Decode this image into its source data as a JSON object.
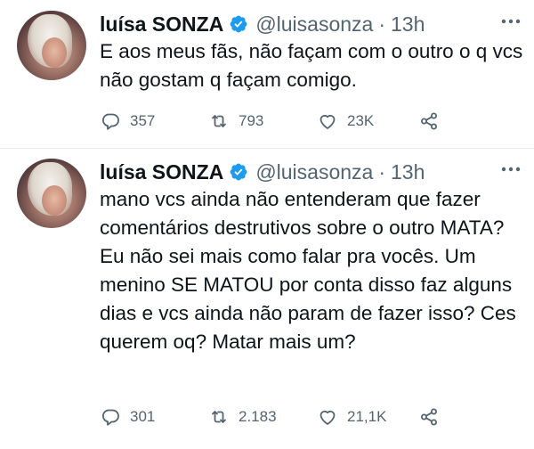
{
  "tweets": [
    {
      "author": {
        "name": "luísa SONZA",
        "handle": "@luisasonza",
        "verified": true
      },
      "separator": "·",
      "time": "13h",
      "text": "E aos meus fãs, não façam com o outro o q vcs não gostam q façam comigo.",
      "stats": {
        "replies": "357",
        "retweets": "793",
        "likes": "23K"
      }
    },
    {
      "author": {
        "name": "luísa SONZA",
        "handle": "@luisasonza",
        "verified": true
      },
      "separator": "·",
      "time": "13h",
      "text": "mano vcs ainda não entenderam que fazer comentários destrutivos sobre o outro MATA? Eu não sei mais como falar pra vocês. Um menino SE MATOU por conta disso faz alguns dias e vcs ainda não param de fazer isso? Ces querem oq? Matar mais um?",
      "stats": {
        "replies": "301",
        "retweets": "2.183",
        "likes": "21,1K"
      }
    }
  ],
  "colors": {
    "text": "#0f1419",
    "muted": "#536471",
    "verified": "#1d9bf0",
    "divider": "#e6ecf0"
  },
  "icons": [
    "verified-badge-icon",
    "more-icon",
    "reply-icon",
    "retweet-icon",
    "like-icon",
    "share-icon"
  ]
}
